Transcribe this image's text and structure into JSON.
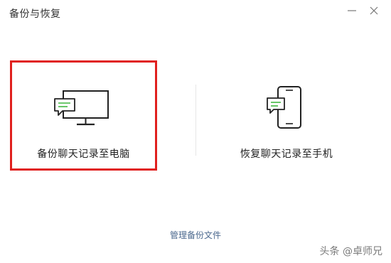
{
  "window": {
    "title": "备份与恢复"
  },
  "options": {
    "backup_to_pc": {
      "label": "备份聊天记录至电脑",
      "selected": true
    },
    "restore_to_phone": {
      "label": "恢复聊天记录至手机",
      "selected": false
    }
  },
  "footer": {
    "manage_link": "管理备份文件"
  },
  "watermark": {
    "text": "头条 @卓师兄"
  },
  "icons": {
    "minimize": "minimize-icon",
    "close": "close-icon",
    "computer": "computer-with-chat-icon",
    "phone": "phone-with-chat-icon"
  },
  "colors": {
    "selection_border": "#e0201e",
    "chat_green": "#3fb73f",
    "link": "#4d6a8f"
  }
}
